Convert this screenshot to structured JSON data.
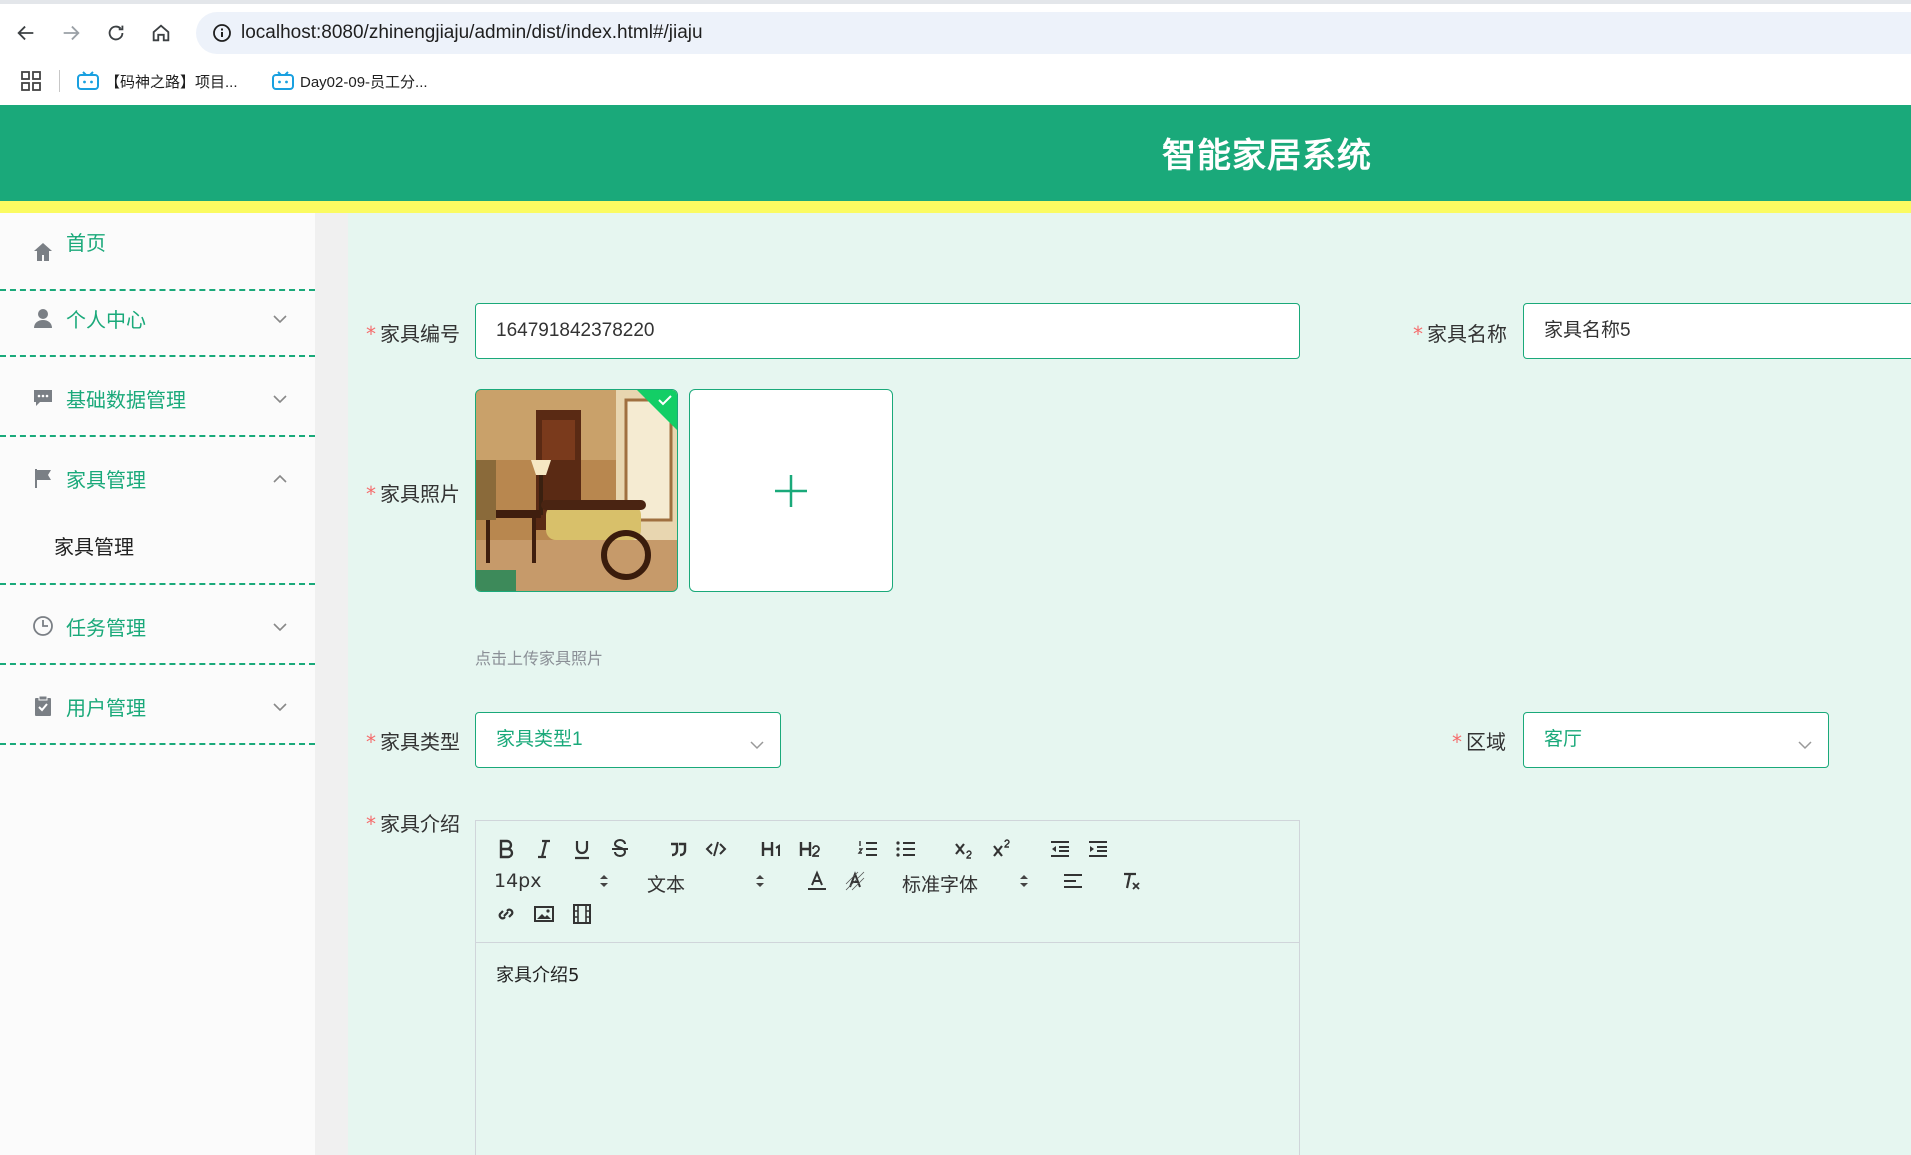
{
  "browser": {
    "url": "localhost:8080/zhinengjiaju/admin/dist/index.html#/jiaju",
    "bookmarks": [
      {
        "label": "【码神之路】项目..."
      },
      {
        "label": "Day02-09-员工分..."
      }
    ]
  },
  "header": {
    "title": "智能家居系统",
    "accent_color": "#1aa97a",
    "stripe_color": "#fbfb61"
  },
  "sidebar": {
    "items": [
      {
        "label": "首页",
        "icon": "home-icon"
      },
      {
        "label": "个人中心",
        "icon": "user-icon"
      },
      {
        "label": "基础数据管理",
        "icon": "message-icon"
      },
      {
        "label": "家具管理",
        "icon": "flag-icon",
        "expanded": true,
        "children": [
          {
            "label": "家具管理"
          }
        ]
      },
      {
        "label": "任务管理",
        "icon": "clock-icon"
      },
      {
        "label": "用户管理",
        "icon": "clipboard-check-icon"
      }
    ]
  },
  "form": {
    "code": {
      "label": "家具编号",
      "value": "164791842378220"
    },
    "name": {
      "label": "家具名称",
      "value": "家具名称5"
    },
    "photo": {
      "label": "家具照片",
      "hint": "点击上传家具照片"
    },
    "type": {
      "label": "家具类型",
      "value": "家具类型1"
    },
    "area": {
      "label": "区域",
      "value": "客厅"
    },
    "intro": {
      "label": "家具介绍",
      "font_size": "14px",
      "text_style": "文本",
      "font_family": "标准字体",
      "content": "家具介绍5"
    }
  }
}
